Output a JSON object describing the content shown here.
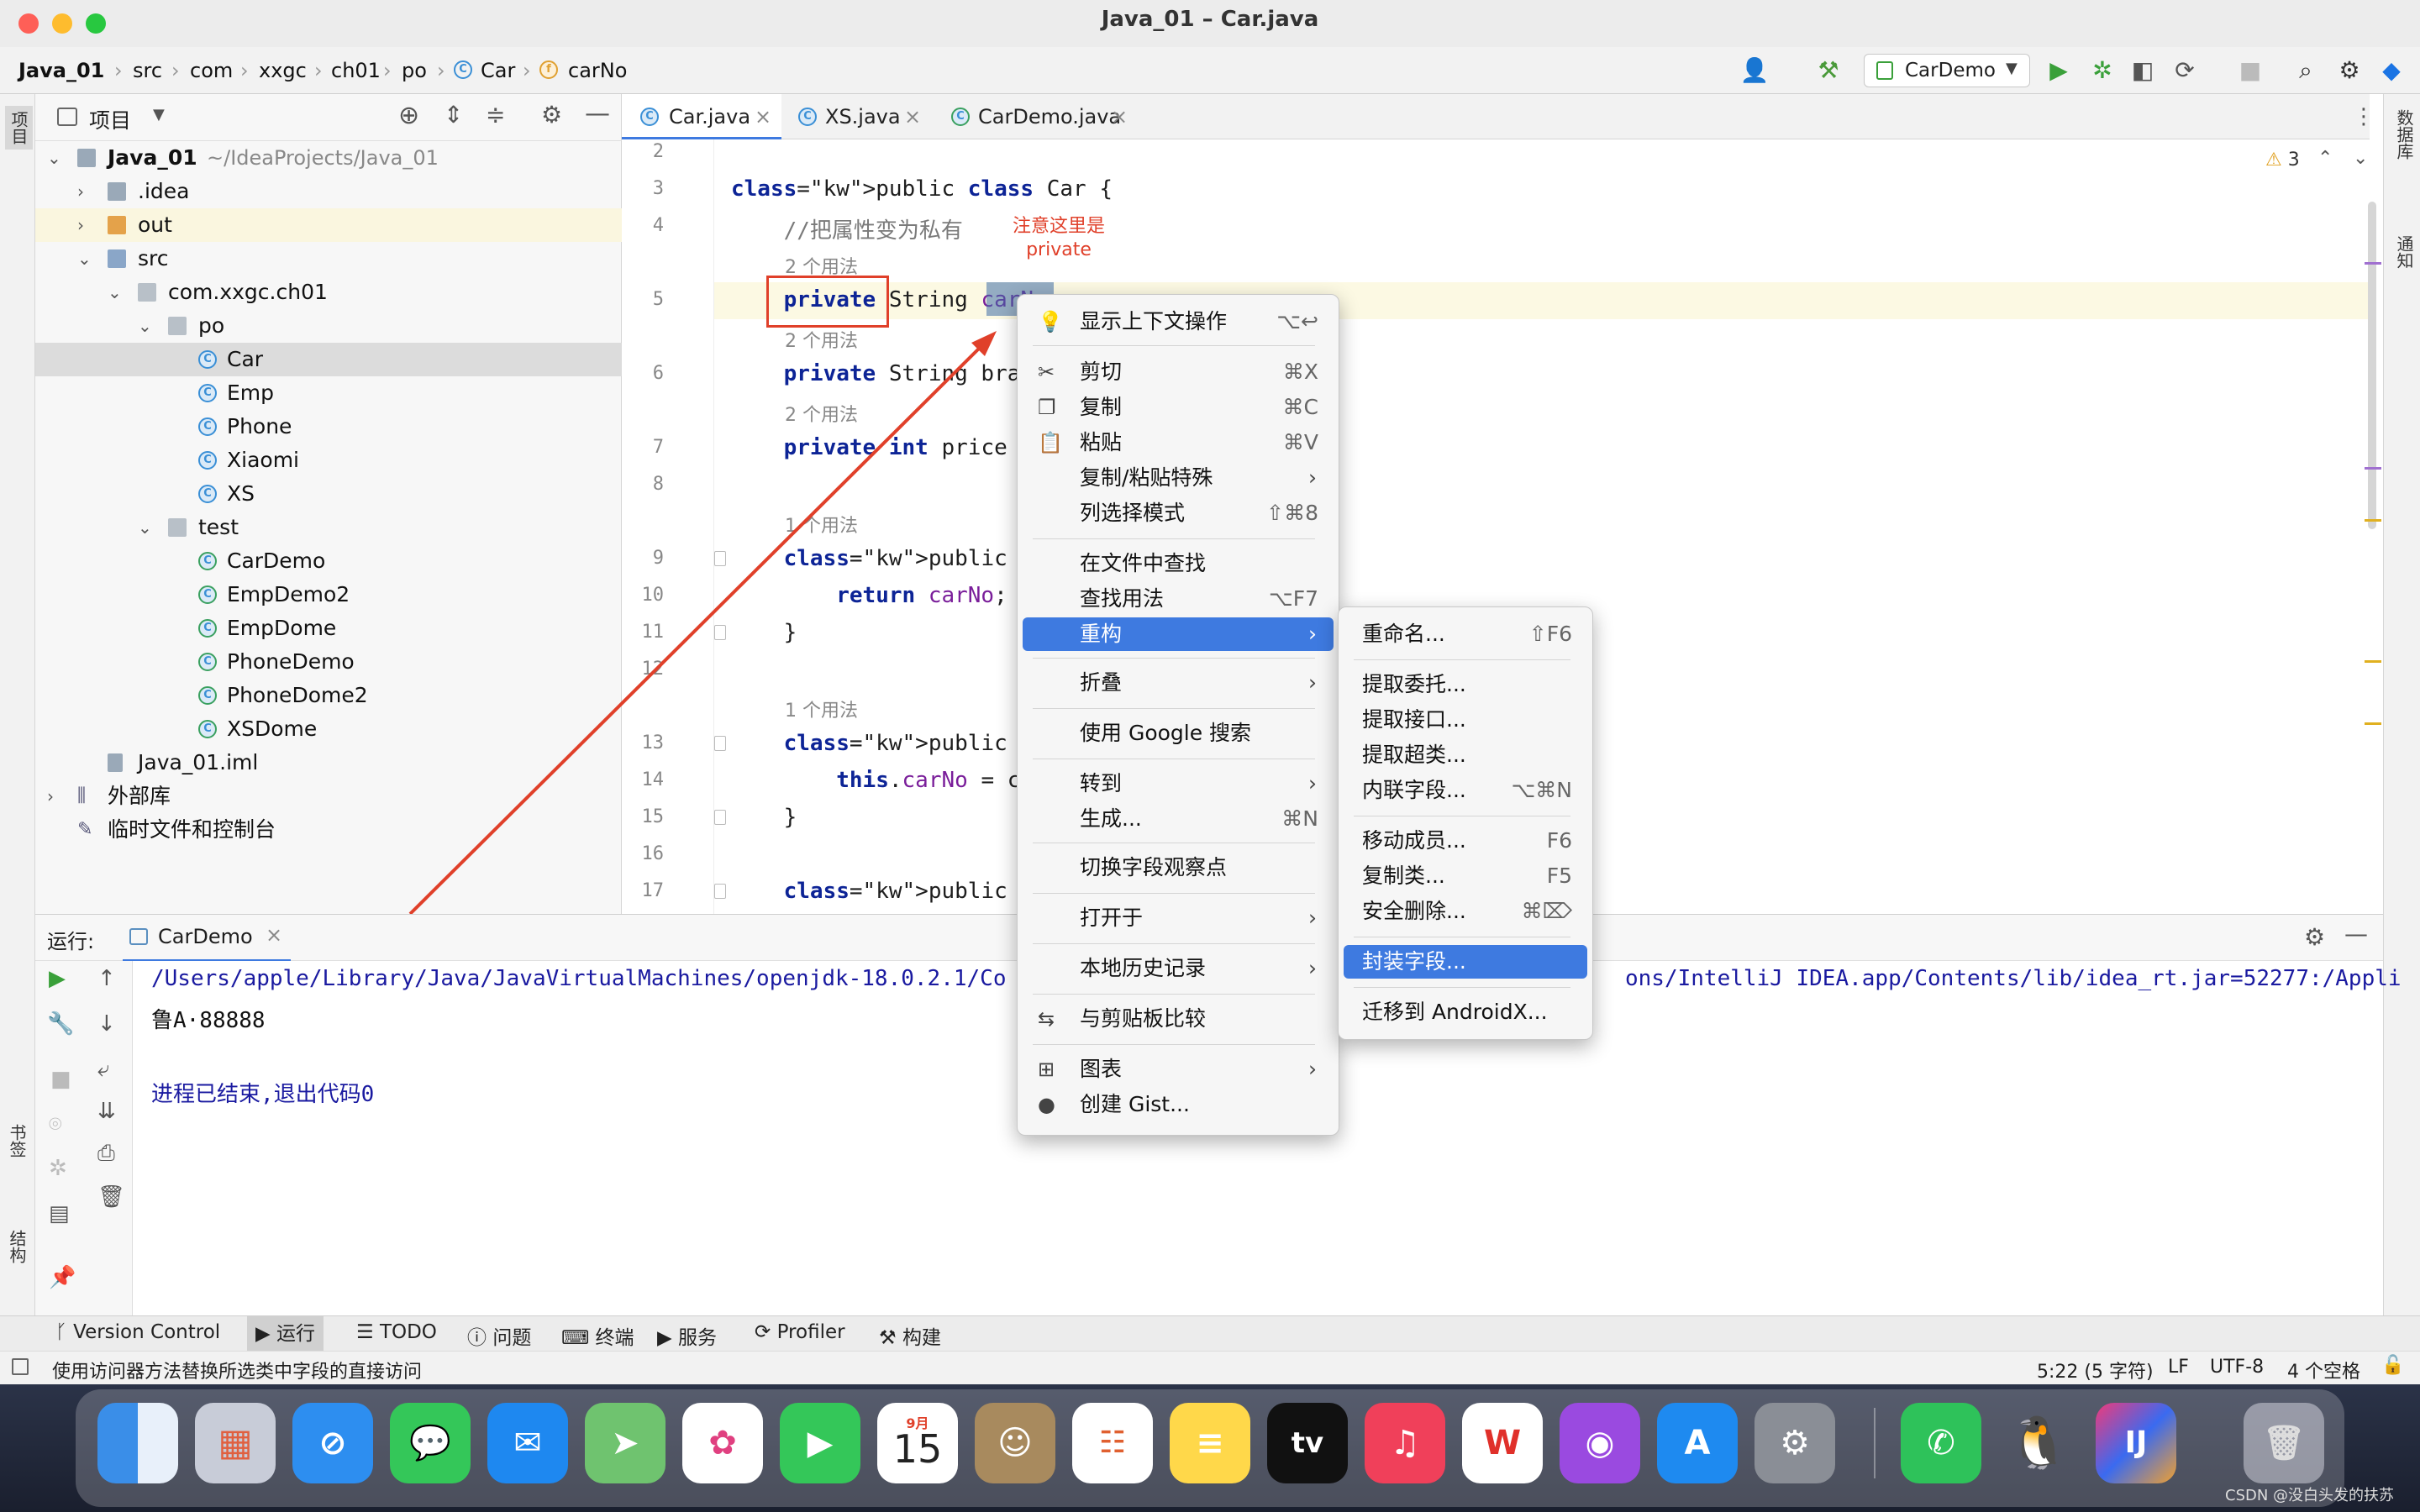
{
  "window": {
    "title": "Java_01 – Car.java"
  },
  "breadcrumb": {
    "items": [
      "Java_01",
      "src",
      "com",
      "xxgc",
      "ch01",
      "po",
      "Car",
      "carNo"
    ]
  },
  "run_config": {
    "name": "CarDemo"
  },
  "left_strip": {
    "project": "项目",
    "bookmarks": "书签",
    "structure": "结构"
  },
  "right_strip": {
    "database": "数据库",
    "notifications": "通知"
  },
  "project_panel": {
    "title": "项目",
    "tree": [
      {
        "label": "Java_01",
        "suffix": "~/IdeaProjects/Java_01",
        "level": 0,
        "icon": "module-folder",
        "expanded": true
      },
      {
        "label": ".idea",
        "level": 1,
        "icon": "folder",
        "expanded": false
      },
      {
        "label": "out",
        "level": 1,
        "icon": "folder-orange",
        "expanded": false
      },
      {
        "label": "src",
        "level": 1,
        "icon": "folder",
        "expanded": true
      },
      {
        "label": "com.xxgc.ch01",
        "level": 2,
        "icon": "package",
        "expanded": true
      },
      {
        "label": "po",
        "level": 3,
        "icon": "package",
        "expanded": true
      },
      {
        "label": "Car",
        "level": 4,
        "icon": "class",
        "selected": true
      },
      {
        "label": "Emp",
        "level": 4,
        "icon": "class"
      },
      {
        "label": "Phone",
        "level": 4,
        "icon": "class"
      },
      {
        "label": "Xiaomi",
        "level": 4,
        "icon": "class"
      },
      {
        "label": "XS",
        "level": 4,
        "icon": "class"
      },
      {
        "label": "test",
        "level": 3,
        "icon": "package",
        "expanded": true
      },
      {
        "label": "CarDemo",
        "level": 4,
        "icon": "runnable-class"
      },
      {
        "label": "EmpDemo2",
        "level": 4,
        "icon": "runnable-class"
      },
      {
        "label": "EmpDome",
        "level": 4,
        "icon": "runnable-class"
      },
      {
        "label": "PhoneDemo",
        "level": 4,
        "icon": "runnable-class"
      },
      {
        "label": "PhoneDome2",
        "level": 4,
        "icon": "runnable-class"
      },
      {
        "label": "XSDome",
        "level": 4,
        "icon": "runnable-class"
      },
      {
        "label": "Java_01.iml",
        "level": 2,
        "icon": "iml-file"
      },
      {
        "label": "外部库",
        "level": 0,
        "icon": "library",
        "expanded": false
      },
      {
        "label": "临时文件和控制台",
        "level": 0,
        "icon": "scratch"
      }
    ]
  },
  "editor": {
    "tabs": [
      {
        "label": "Car.java",
        "active": true
      },
      {
        "label": "XS.java"
      },
      {
        "label": "CarDemo.java"
      }
    ],
    "warnings": "3",
    "annotation": {
      "line1": "注意这里是",
      "line2": "private"
    },
    "lines": [
      {
        "n": "2",
        "text": ""
      },
      {
        "n": "3",
        "text": "public class Car {"
      },
      {
        "n": "4",
        "text": "    //把属性变为私有"
      },
      {
        "hint": "2 个用法"
      },
      {
        "n": "5",
        "text": "    private String carNo"
      },
      {
        "hint": "2 个用法"
      },
      {
        "n": "6",
        "text": "    private String bra"
      },
      {
        "hint": "2 个用法"
      },
      {
        "n": "7",
        "text": "    private int price"
      },
      {
        "n": "8",
        "text": ""
      },
      {
        "hint": "1 个用法"
      },
      {
        "n": "9",
        "text": "    public String getC"
      },
      {
        "n": "10",
        "text": "        return carNo;"
      },
      {
        "n": "11",
        "text": "    }"
      },
      {
        "n": "12",
        "text": ""
      },
      {
        "hint": "1 个用法"
      },
      {
        "n": "13",
        "text": "    public void setCar"
      },
      {
        "n": "14",
        "text": "        this.carNo = c"
      },
      {
        "n": "15",
        "text": "    }"
      },
      {
        "n": "16",
        "text": ""
      },
      {
        "n": "17",
        "text": "    public String getB"
      }
    ]
  },
  "context_menu": {
    "items": [
      {
        "icon": "bulb-icon",
        "label": "显示上下文操作",
        "shortcut": "⌥↩"
      },
      {
        "sep": true
      },
      {
        "icon": "scissors-icon",
        "label": "剪切",
        "shortcut": "⌘X"
      },
      {
        "icon": "copy-icon",
        "label": "复制",
        "shortcut": "⌘C"
      },
      {
        "icon": "paste-icon",
        "label": "粘贴",
        "shortcut": "⌘V"
      },
      {
        "label": "复制/粘贴特殊",
        "submenu": true
      },
      {
        "label": "列选择模式",
        "shortcut": "⇧⌘8"
      },
      {
        "sep": true
      },
      {
        "label": "在文件中查找"
      },
      {
        "label": "查找用法",
        "shortcut": "⌥F7"
      },
      {
        "label": "重构",
        "submenu": true,
        "selected": true
      },
      {
        "sep": true
      },
      {
        "label": "折叠",
        "submenu": true
      },
      {
        "sep": true
      },
      {
        "label": "使用 Google 搜索"
      },
      {
        "sep": true
      },
      {
        "label": "转到",
        "submenu": true
      },
      {
        "label": "生成...",
        "shortcut": "⌘N"
      },
      {
        "sep": true
      },
      {
        "label": "切换字段观察点"
      },
      {
        "sep": true
      },
      {
        "label": "打开于",
        "submenu": true
      },
      {
        "sep": true
      },
      {
        "label": "本地历史记录",
        "submenu": true
      },
      {
        "sep": true
      },
      {
        "icon": "compare-icon",
        "label": "与剪贴板比较"
      },
      {
        "sep": true
      },
      {
        "icon": "diagram-icon",
        "label": "图表",
        "submenu": true
      },
      {
        "icon": "github-icon",
        "label": "创建 Gist..."
      }
    ]
  },
  "refactor_menu": {
    "items": [
      {
        "label": "重命名...",
        "shortcut": "⇧F6"
      },
      {
        "sep": true
      },
      {
        "label": "提取委托..."
      },
      {
        "label": "提取接口..."
      },
      {
        "label": "提取超类..."
      },
      {
        "label": "内联字段...",
        "shortcut": "⌥⌘N"
      },
      {
        "sep": true
      },
      {
        "label": "移动成员...",
        "shortcut": "F6"
      },
      {
        "label": "复制类...",
        "shortcut": "F5"
      },
      {
        "label": "安全删除...",
        "shortcut": "⌘⌦"
      },
      {
        "sep": true
      },
      {
        "label": "封装字段...",
        "selected": true
      },
      {
        "sep": true
      },
      {
        "label": "迁移到 AndroidX..."
      }
    ]
  },
  "run_panel": {
    "label": "运行:",
    "tab": "CarDemo",
    "console_line1": "/Users/apple/Library/Java/JavaVirtualMachines/openjdk-18.0.2.1/Co",
    "console_line1_tail": "ons/IntelliJ IDEA.app/Contents/lib/idea_rt.jar=52277:/Appli",
    "output": "鲁A·88888",
    "exit": "进程已结束,退出代码0"
  },
  "tool_windows": [
    {
      "icon": "vcs-icon",
      "label": "Version Control"
    },
    {
      "icon": "run-icon",
      "label": "运行",
      "active": true
    },
    {
      "icon": "todo-icon",
      "label": "TODO"
    },
    {
      "icon": "problems-icon",
      "label": "问题"
    },
    {
      "icon": "terminal-icon",
      "label": "终端"
    },
    {
      "icon": "services-icon",
      "label": "服务"
    },
    {
      "icon": "profiler-icon",
      "label": "Profiler"
    },
    {
      "icon": "build-icon",
      "label": "构建"
    }
  ],
  "status_bar": {
    "message": "使用访问器方法替换所选类中字段的直接访问",
    "position": "5:22 (5 字符)",
    "line_sep": "LF",
    "encoding": "UTF-8",
    "indent": "4 个空格"
  },
  "dock": {
    "calendar_month": "9月",
    "calendar_day": "15",
    "appletv": "tv",
    "watermark": "CSDN @没白头发的扶苏"
  }
}
